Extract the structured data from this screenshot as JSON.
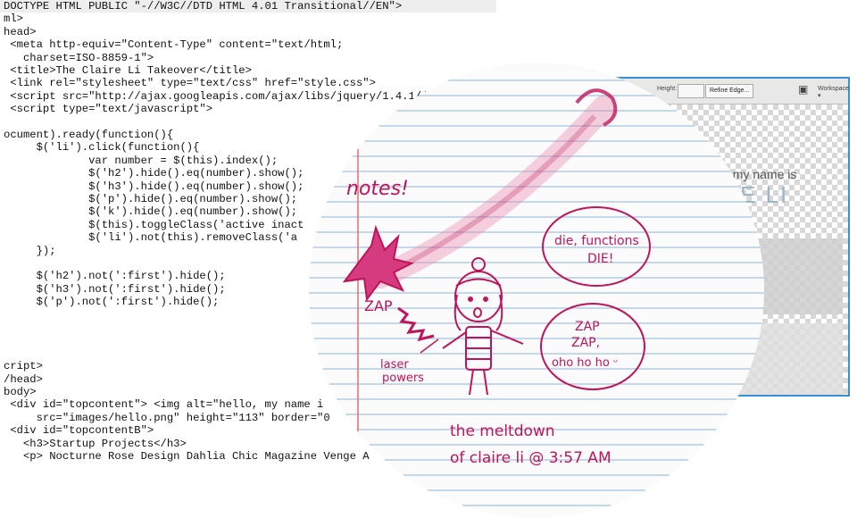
{
  "code_lines": [
    "DOCTYPE HTML PUBLIC \"-//W3C//DTD HTML 4.01 Transitional//EN\">",
    "ml>",
    "head>",
    " <meta http-equiv=\"Content-Type\" content=\"text/html;",
    "   charset=ISO-8859-1\">",
    " <title>The Claire Li Takeover</title>",
    " <link rel=\"stylesheet\" type=\"text/css\" href=\"style.css\">",
    " <script src=\"http://ajax.googleapis.com/ajax/libs/jquery/1.4.1/j",
    " <script type=\"text/javascript\">",
    "",
    "ocument).ready(function(){",
    "     $('li').click(function(){",
    "             var number = $(this).index();",
    "             $('h2').hide().eq(number).show();",
    "             $('h3').hide().eq(number).show();",
    "             $('p').hide().eq(number).show();",
    "             $('k').hide().eq(number).show();",
    "             $(this).toggleClass('active inact",
    "             $('li').not(this).removeClass('a",
    "     });",
    "",
    "     $('h2').not(':first').hide();",
    "     $('h3').not(':first').hide();",
    "     $('p').not(':first').hide();",
    "",
    "",
    "",
    "",
    "cript>",
    "/head>",
    "body>",
    " <div id=\"topcontent\"> <img alt=\"hello, my name i",
    "     src=\"images/hello.png\" height=\"113\" border=\"0",
    " <div id=\"topcontentB\">",
    "   <h3>Startup Projects</h3>",
    "   <p> Nocturne Rose Design Dahlia Chic Magazine Venge A"
  ],
  "window": {
    "height_label": "Height:",
    "refine_button": "Refine Edge...",
    "workspace_label": "Workspace ▾",
    "hello_text": "llo, my name is",
    "name_text": "IRE LI"
  },
  "doodle": {
    "notes_text": "notes!",
    "zap_text": "ZAP",
    "laser_text_1": "laser",
    "laser_text_2": "powers",
    "speech1_line1": "die, functions",
    "speech1_line2": "DIE!",
    "speech2_line1": "ZAP",
    "speech2_line2": "ZAP,",
    "speech2_line3": "oho ho ho ᵕ",
    "caption_line1": "the meltdown",
    "caption_line2": "of claire li @ 3:57 AM"
  },
  "colors": {
    "ink": "#c0145a",
    "window_border": "#3a8fd6",
    "rule_line": "#8fb6d8",
    "margin_line": "#e07070"
  }
}
